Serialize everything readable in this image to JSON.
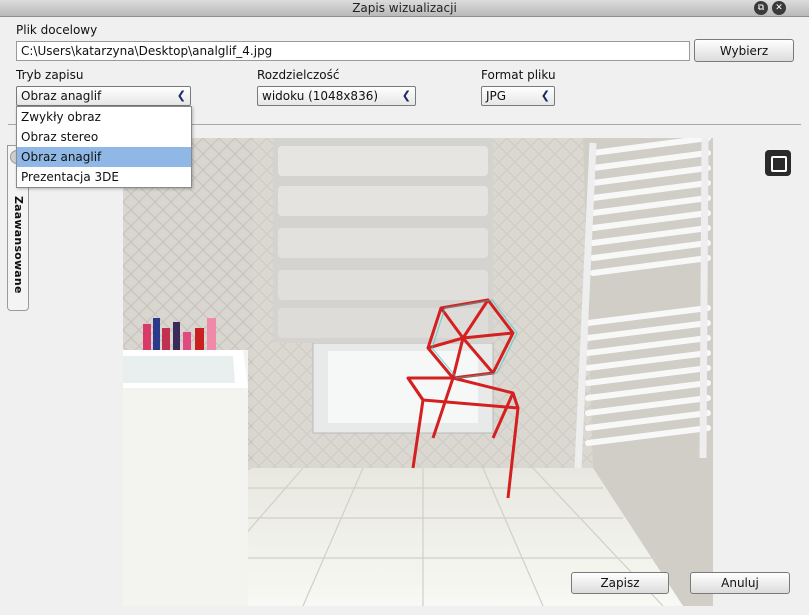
{
  "window": {
    "title": "Zapis wizualizacji",
    "restore_icon": "restore-icon",
    "close_icon": "close-icon"
  },
  "target_file": {
    "label": "Plik docelowy",
    "value": "C:\\Users\\katarzyna\\Desktop\\analglif_4.jpg",
    "browse_label": "Wybierz"
  },
  "save_mode": {
    "label": "Tryb zapisu",
    "selected": "Obraz anaglif",
    "options": [
      "Zwykły obraz",
      "Obraz stereo",
      "Obraz anaglif",
      "Prezentacja 3DE"
    ]
  },
  "resolution": {
    "label": "Rozdzielczość",
    "selected": "widoku (1048x836)"
  },
  "file_format": {
    "label": "Format pliku",
    "selected": "JPG"
  },
  "side_tab": {
    "label": "Zaawansowane"
  },
  "preview": {
    "fullscreen_icon": "fullscreen-icon"
  },
  "footer": {
    "save_label": "Zapisz",
    "cancel_label": "Anuluj"
  },
  "colors": {
    "selected_option": "#8fb8e6",
    "chair_red": "#d42020",
    "window_bg": "#f0f0f0"
  }
}
